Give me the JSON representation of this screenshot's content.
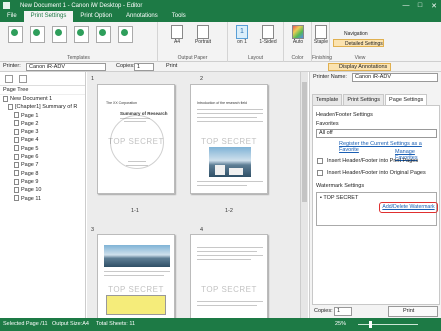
{
  "window": {
    "title": "New Document 1 - Canon iW Desktop - Editor",
    "controls": [
      "—",
      "□",
      "✕"
    ]
  },
  "ribbon_tabs": [
    "File",
    "Print Settings",
    "Print Option",
    "Annotations",
    "Tools"
  ],
  "ribbon": {
    "groups": {
      "templates": "Templates",
      "output_paper": "Output Paper",
      "layout": "Layout",
      "color": "Color",
      "finishing": "Finishing",
      "view": "View"
    },
    "paper_size": "A4",
    "orientation": "Portrait",
    "pages_per_sheet_value": "1",
    "pages_per_sheet_label": "on 1",
    "print_sides": "1-Sided",
    "color_mode": "Auto",
    "color_label": "Color",
    "staple": "Staple",
    "navigation": "Navigation",
    "detailed_settings": "Detailed Settings"
  },
  "toolbar": {
    "printer_label": "Printer:",
    "printer_value": "Canon iR-ADV",
    "copies_label": "Copies:",
    "copies_value": "1",
    "print_label": "Print",
    "display_annotations": "Display Annotations"
  },
  "tree": {
    "title": "Page Tree",
    "root": "New Document 1",
    "chapter": "[Chapter1] Summary of R",
    "pages": [
      "Page 1",
      "Page 2",
      "Page 3",
      "Page 4",
      "Page 5",
      "Page 6",
      "Page 7",
      "Page 8",
      "Page 9",
      "Page 10",
      "Page 11"
    ]
  },
  "preview": {
    "sheet_numbers": [
      "1",
      "2",
      "3",
      "4"
    ],
    "spread_labels": [
      "1-1",
      "1-2"
    ],
    "watermark_text": "TOP SECRET",
    "page1": {
      "header": "The XX Corporation",
      "title": "Summary of Research"
    },
    "page2": {
      "header": "Introduction of the research field"
    }
  },
  "right_panel": {
    "printer_label": "Printer Name:",
    "printer_value": "Canon iR-ADV",
    "tabs": [
      "Template",
      "Print Settings",
      "Page Settings"
    ],
    "header_footer_settings": "Header/Footer Settings",
    "favorites_label": "Favorites",
    "favorites_value": "All off",
    "register_link": "Register the Current Settings as a Favorite",
    "manage_link": "Manage Favorites",
    "insert_print_pages": "Insert Header/Footer into Print Pages",
    "insert_original_pages": "Insert Header/Footer into Original Pages",
    "watermark_settings": "Watermark Settings",
    "watermark_item": "TOP SECRET",
    "add_delete_watermark": "Add/Delete Watermark",
    "copies_label": "Copies:",
    "copies_value": "1",
    "print_button": "Print"
  },
  "status": {
    "selected_page": "Selected Page /11",
    "output_size": "Output Size:A4",
    "total_sheets": "Total Sheets: 11",
    "zoom": "25%"
  },
  "colors": {
    "accent": "#1d7a45",
    "highlight": "#e03030"
  }
}
